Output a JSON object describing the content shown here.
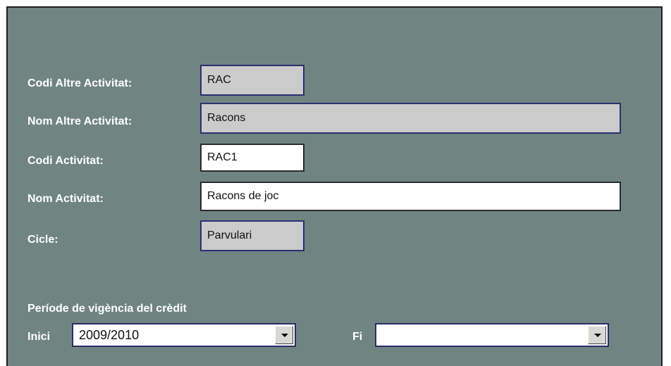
{
  "form": {
    "codi_altre_label": "Codi Altre Activitat:",
    "codi_altre_value": "RAC",
    "nom_altre_label": "Nom Altre Activitat:",
    "nom_altre_value": "Racons",
    "codi_activitat_label": "Codi Activitat:",
    "codi_activitat_value": "RAC1",
    "nom_activitat_label": "Nom Activitat:",
    "nom_activitat_value": "Racons de joc",
    "cicle_label": "Cicle:",
    "cicle_value": "Parvulari"
  },
  "period": {
    "title": "Període de vigència del crèdit",
    "inici_label": "Inici",
    "inici_value": "2009/2010",
    "fi_label": "Fi",
    "fi_value": ""
  },
  "colors": {
    "panel_bg": "#708581",
    "readonly_bg": "#cbcbcb",
    "readonly_border": "#2d2f73",
    "label_text": "#ffffff"
  },
  "icons": {
    "dropdown": "chevron-down-icon"
  }
}
